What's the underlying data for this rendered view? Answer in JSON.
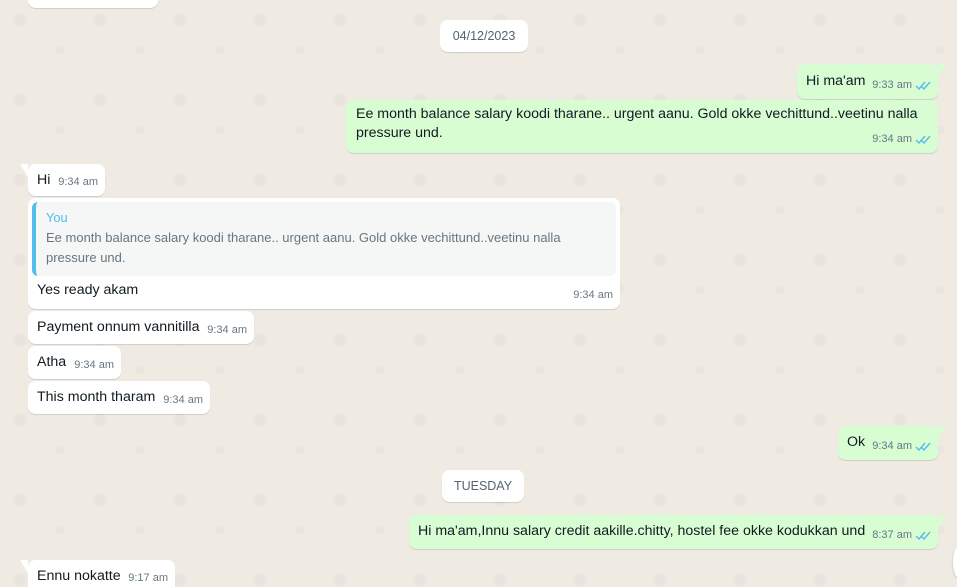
{
  "date_chips": {
    "first": "04/12/2023",
    "second": "TUESDAY"
  },
  "messages": [
    {
      "id": "m1",
      "text": "Hi ma'am",
      "time": "9:33 am"
    },
    {
      "id": "m2",
      "text": "Ee month balance salary koodi tharane.. urgent aanu. Gold okke vechittund..veetinu nalla pressure und.",
      "time": "9:34 am"
    },
    {
      "id": "m3",
      "text": "Hi",
      "time": "9:34 am"
    },
    {
      "id": "m4",
      "text": "Yes ready akam",
      "time": "9:34 am",
      "quote": {
        "author": "You",
        "text": "Ee month balance salary koodi tharane.. urgent aanu. Gold okke vechittund..veetinu nalla pressure und."
      }
    },
    {
      "id": "m5",
      "text": "Payment onnum vannitilla",
      "time": "9:34 am"
    },
    {
      "id": "m6",
      "text": "Atha",
      "time": "9:34 am"
    },
    {
      "id": "m7",
      "text": "This month tharam",
      "time": "9:34 am"
    },
    {
      "id": "m8",
      "text": "Ok",
      "time": "9:34 am"
    },
    {
      "id": "m9",
      "text": "Hi ma'am,Innu salary credit aakille.chitty, hostel fee okke kodukkan und",
      "time": "8:37 am"
    },
    {
      "id": "m10",
      "text": "Ennu nokatte",
      "time": "9:17 am"
    }
  ],
  "icons": {
    "read_receipt": "double-check-icon",
    "read_color": "#53bdeb"
  },
  "colors": {
    "background": "#efeae2",
    "incoming": "#ffffff",
    "outgoing": "#d9fdd3",
    "quote_accent": "#53bdeb"
  }
}
